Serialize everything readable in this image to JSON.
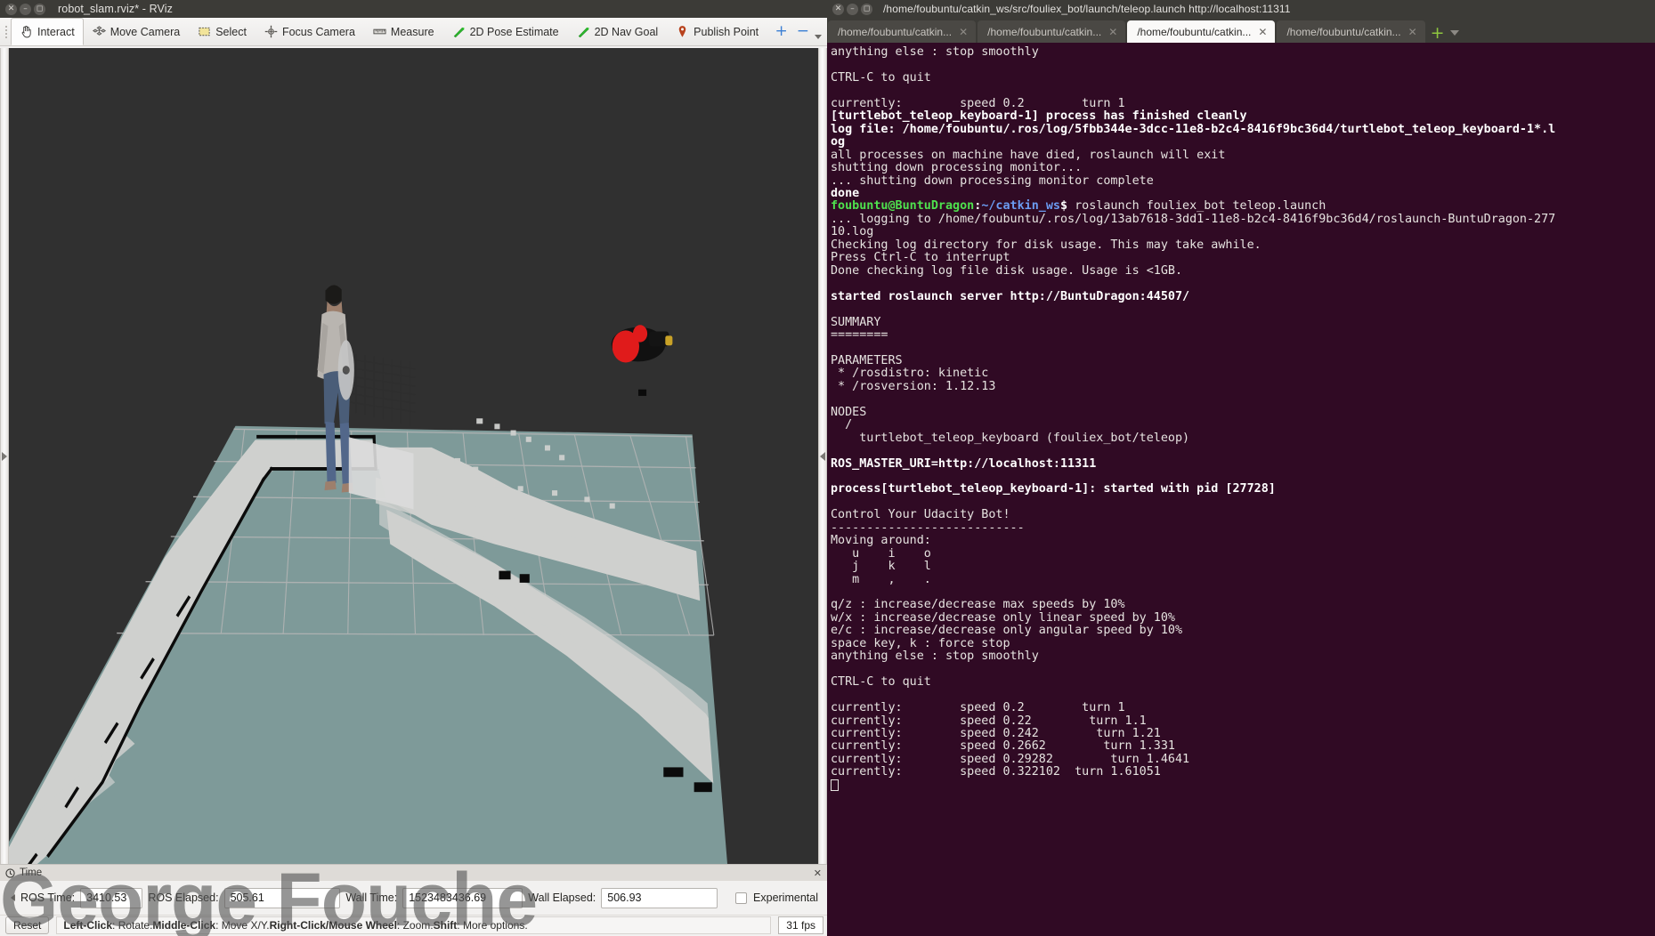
{
  "rviz": {
    "window_title": "robot_slam.rviz* - RViz",
    "window_buttons": [
      "close",
      "minimize",
      "maximize"
    ],
    "toolbar": [
      {
        "label": "Interact",
        "icon": "hand-cursor-icon",
        "active": true
      },
      {
        "label": "Move Camera",
        "icon": "move-camera-icon",
        "active": false
      },
      {
        "label": "Select",
        "icon": "select-rect-icon",
        "active": false
      },
      {
        "label": "Focus Camera",
        "icon": "focus-camera-icon",
        "active": false
      },
      {
        "label": "Measure",
        "icon": "ruler-icon",
        "active": false
      },
      {
        "label": "2D Pose Estimate",
        "icon": "pose-arrow-icon",
        "active": false
      },
      {
        "label": "2D Nav Goal",
        "icon": "nav-goal-arrow-icon",
        "active": false
      },
      {
        "label": "Publish Point",
        "icon": "map-pin-icon",
        "active": false
      }
    ],
    "toolbar_right": {
      "add": "+",
      "remove": "−",
      "overflow": "chevron-down-icon"
    },
    "time_panel": {
      "header": "Time",
      "close": "✕",
      "fields": [
        {
          "label": "ROS Time:",
          "value": "3410.53"
        },
        {
          "label": "ROS Elapsed:",
          "value": "505.61"
        },
        {
          "label": "Wall Time:",
          "value": "1523483436.69"
        },
        {
          "label": "Wall Elapsed:",
          "value": "506.93"
        }
      ],
      "experimental_label": "Experimental",
      "experimental_checked": false
    },
    "status_bar": {
      "reset_label": "Reset",
      "hint_parts": [
        {
          "text": "Left-Click",
          "bold": true
        },
        {
          "text": ": Rotate.  ",
          "bold": false
        },
        {
          "text": "Middle-Click",
          "bold": true
        },
        {
          "text": ": Move X/Y.  ",
          "bold": false
        },
        {
          "text": "Right-Click/Mouse Wheel",
          "bold": true
        },
        {
          "text": ": Zoom.  ",
          "bold": false
        },
        {
          "text": "Shift",
          "bold": true
        },
        {
          "text": ": More options.",
          "bold": false
        }
      ],
      "fps": "31 fps"
    },
    "watermark": "George Fouche",
    "viewport": {
      "background_color": "#303030",
      "grid_color": "#b9b9b9",
      "free_space_color": "#cfd0ce",
      "map_plane_color": "#7e9a99",
      "obstacle_color": "#0b0b0b",
      "robot_marker_color": "#e01b1b",
      "description": "3D SLAM occupancy grid map with robot marker and human model"
    }
  },
  "terminal": {
    "window_title": "/home/foubuntu/catkin_ws/src/fouliex_bot/launch/teleop.launch http://localhost:11311",
    "window_buttons": [
      "close",
      "minimize",
      "maximize"
    ],
    "tabs": [
      {
        "label": "/home/foubuntu/catkin...",
        "active": false
      },
      {
        "label": "/home/foubuntu/catkin...",
        "active": false
      },
      {
        "label": "/home/foubuntu/catkin...",
        "active": true
      },
      {
        "label": "/home/foubuntu/catkin...",
        "active": false
      }
    ],
    "tab_add_label": "+",
    "colors": {
      "background": "#300a24",
      "text": "#e6e3e0",
      "prompt_user": "#4ee24e",
      "prompt_path": "#6b9cf2"
    },
    "lines": [
      {
        "t": "anything else : stop smoothly"
      },
      {
        "t": ""
      },
      {
        "t": "CTRL-C to quit"
      },
      {
        "t": ""
      },
      {
        "t": "currently:\tspeed 0.2\tturn 1"
      },
      {
        "t": "[turtlebot_teleop_keyboard-1] process has finished cleanly",
        "b": true
      },
      {
        "t": "log file: /home/foubuntu/.ros/log/5fbb344e-3dcc-11e8-b2c4-8416f9bc36d4/turtlebot_teleop_keyboard-1*.l",
        "b": true
      },
      {
        "t": "og",
        "b": true
      },
      {
        "t": "all processes on machine have died, roslaunch will exit"
      },
      {
        "t": "shutting down processing monitor..."
      },
      {
        "t": "... shutting down processing monitor complete"
      },
      {
        "t": "done",
        "b": true
      },
      {
        "prompt": true,
        "user": "foubuntu@BuntuDragon",
        "sep": ":",
        "path": "~/catkin_ws",
        "dollar": "$ ",
        "cmd": "roslaunch fouliex_bot teleop.launch"
      },
      {
        "t": "... logging to /home/foubuntu/.ros/log/13ab7618-3dd1-11e8-b2c4-8416f9bc36d4/roslaunch-BuntuDragon-277"
      },
      {
        "t": "10.log"
      },
      {
        "t": "Checking log directory for disk usage. This may take awhile."
      },
      {
        "t": "Press Ctrl-C to interrupt"
      },
      {
        "t": "Done checking log file disk usage. Usage is <1GB."
      },
      {
        "t": ""
      },
      {
        "t": "started roslaunch server http://BuntuDragon:44507/",
        "b": true
      },
      {
        "t": ""
      },
      {
        "t": "SUMMARY"
      },
      {
        "t": "========"
      },
      {
        "t": ""
      },
      {
        "t": "PARAMETERS"
      },
      {
        "t": " * /rosdistro: kinetic"
      },
      {
        "t": " * /rosversion: 1.12.13"
      },
      {
        "t": ""
      },
      {
        "t": "NODES"
      },
      {
        "t": "  /"
      },
      {
        "t": "    turtlebot_teleop_keyboard (fouliex_bot/teleop)"
      },
      {
        "t": ""
      },
      {
        "t": "ROS_MASTER_URI=http://localhost:11311",
        "b": true
      },
      {
        "t": ""
      },
      {
        "t": "process[turtlebot_teleop_keyboard-1]: started with pid [27728]",
        "b": true
      },
      {
        "t": ""
      },
      {
        "t": "Control Your Udacity Bot!"
      },
      {
        "t": "---------------------------"
      },
      {
        "t": "Moving around:"
      },
      {
        "t": "   u    i    o"
      },
      {
        "t": "   j    k    l"
      },
      {
        "t": "   m    ,    ."
      },
      {
        "t": ""
      },
      {
        "t": "q/z : increase/decrease max speeds by 10%"
      },
      {
        "t": "w/x : increase/decrease only linear speed by 10%"
      },
      {
        "t": "e/c : increase/decrease only angular speed by 10%"
      },
      {
        "t": "space key, k : force stop"
      },
      {
        "t": "anything else : stop smoothly"
      },
      {
        "t": ""
      },
      {
        "t": "CTRL-C to quit"
      },
      {
        "t": ""
      },
      {
        "t": "currently:\tspeed 0.2\tturn 1"
      },
      {
        "t": "currently:\tspeed 0.22\tturn 1.1"
      },
      {
        "t": "currently:\tspeed 0.242\tturn 1.21"
      },
      {
        "t": "currently:\tspeed 0.2662\tturn 1.331"
      },
      {
        "t": "currently:\tspeed 0.29282\tturn 1.4641"
      },
      {
        "t": "currently:\tspeed 0.322102  turn 1.61051"
      },
      {
        "cursor": true
      }
    ]
  }
}
